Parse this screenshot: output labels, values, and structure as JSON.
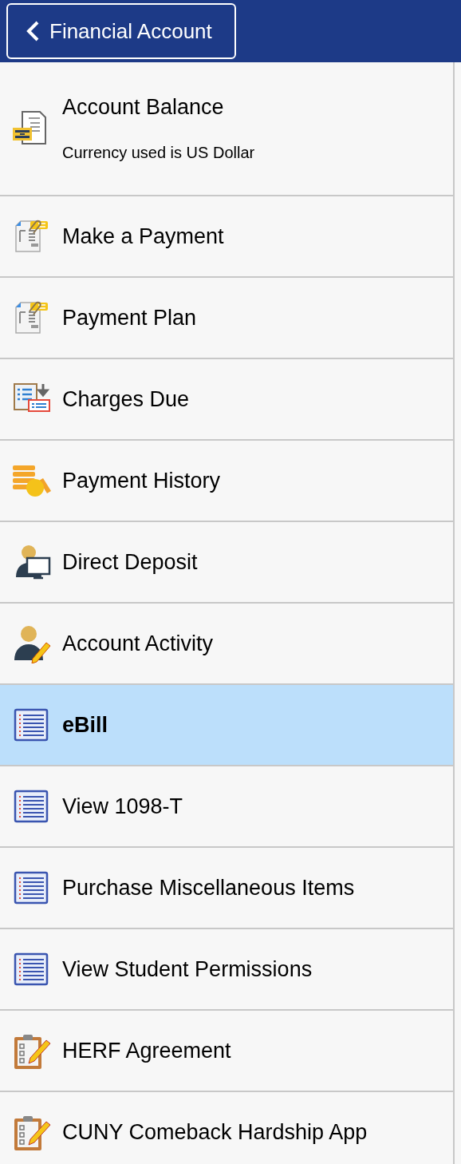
{
  "header": {
    "back_button": {
      "label": "Financial Account"
    }
  },
  "items": [
    {
      "kind": "balance",
      "label": "Account Balance",
      "subtitle": "Currency used is US Dollar",
      "selected": false
    },
    {
      "kind": "payment",
      "label": "Make a Payment",
      "selected": false
    },
    {
      "kind": "payment",
      "label": "Payment Plan",
      "selected": false
    },
    {
      "kind": "charges",
      "label": "Charges Due",
      "selected": false
    },
    {
      "kind": "coins",
      "label": "Payment History",
      "selected": false
    },
    {
      "kind": "deposit",
      "label": "Direct Deposit",
      "selected": false
    },
    {
      "kind": "activity",
      "label": "Account Activity",
      "selected": false
    },
    {
      "kind": "list",
      "label": "eBill",
      "selected": true
    },
    {
      "kind": "list",
      "label": "View 1098-T",
      "selected": false
    },
    {
      "kind": "list",
      "label": "Purchase Miscellaneous Items",
      "selected": false
    },
    {
      "kind": "list",
      "label": "View Student Permissions",
      "selected": false
    },
    {
      "kind": "clipboard",
      "label": "HERF Agreement",
      "selected": false
    },
    {
      "kind": "clipboard",
      "label": "CUNY Comeback Hardship App",
      "selected": false
    }
  ]
}
